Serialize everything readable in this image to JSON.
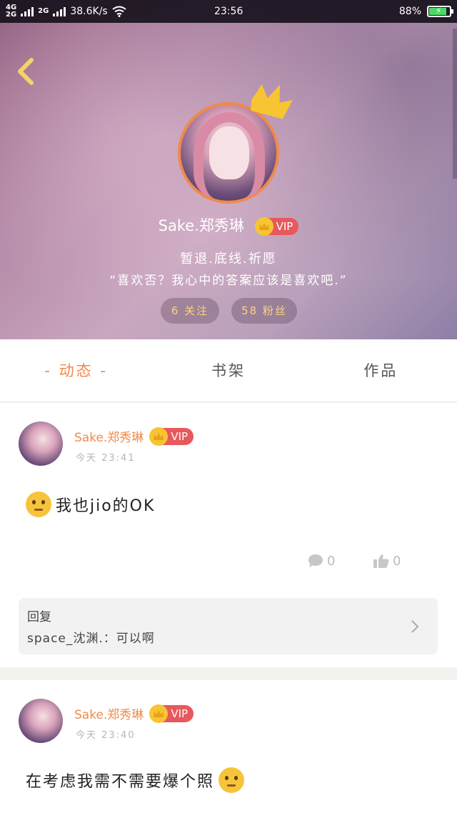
{
  "status_bar": {
    "network_top": "4G",
    "network_bottom": "2G",
    "network2": "2G",
    "speed": "38.6K/s",
    "time": "23:56",
    "battery": "88%"
  },
  "profile": {
    "name": "Sake.郑秀琳",
    "vip": "VIP",
    "signature_line1": "暂退.底线.祈愿",
    "signature_line2": "“喜欢否？我心中的答案应该是喜欢吧.”",
    "following": "6 关注",
    "followers": "58 粉丝"
  },
  "tabs": [
    {
      "label": "- 动态 -"
    },
    {
      "label": "书架"
    },
    {
      "label": "作品"
    }
  ],
  "posts": [
    {
      "author": "Sake.郑秀琳",
      "vip": "VIP",
      "time": "今天 23:41",
      "text": "我也jio的OK",
      "comments": "0",
      "likes": "0",
      "reply_label": "回复",
      "reply_text": "space_沈渊.：可以啊"
    },
    {
      "author": "Sake.郑秀琳",
      "vip": "VIP",
      "time": "今天 23:40",
      "text": "在考虑我需不需要爆个照"
    }
  ],
  "colors": {
    "accent": "#f08a4b",
    "vip": "#e8585c",
    "crown": "#f7c531"
  }
}
